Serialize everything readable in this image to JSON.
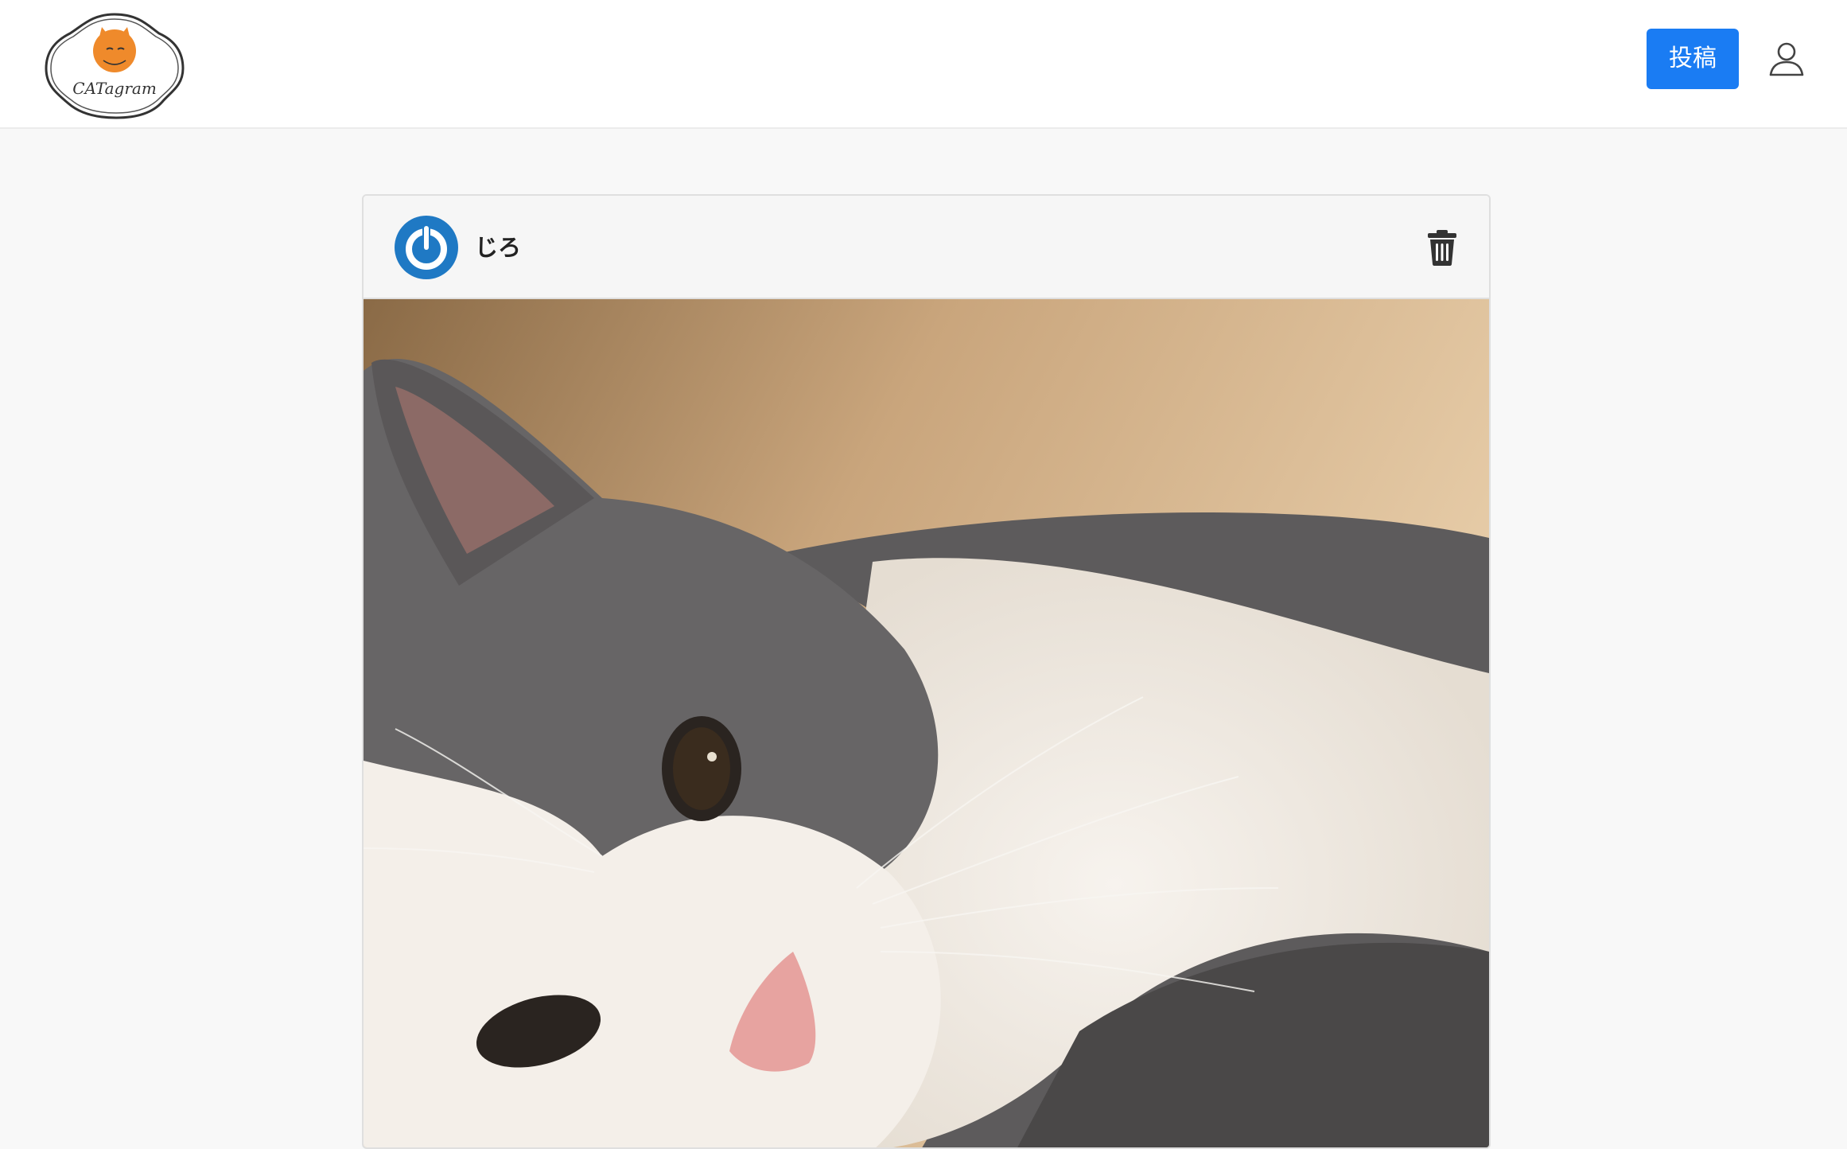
{
  "header": {
    "logo_text": "CATagram",
    "post_button_label": "投稿"
  },
  "post": {
    "username": "じろ",
    "image_description": "cat-photo"
  },
  "colors": {
    "primary": "#1a7cf3",
    "avatar_blue": "#1f79c4",
    "logo_orange": "#ef8a2b"
  }
}
